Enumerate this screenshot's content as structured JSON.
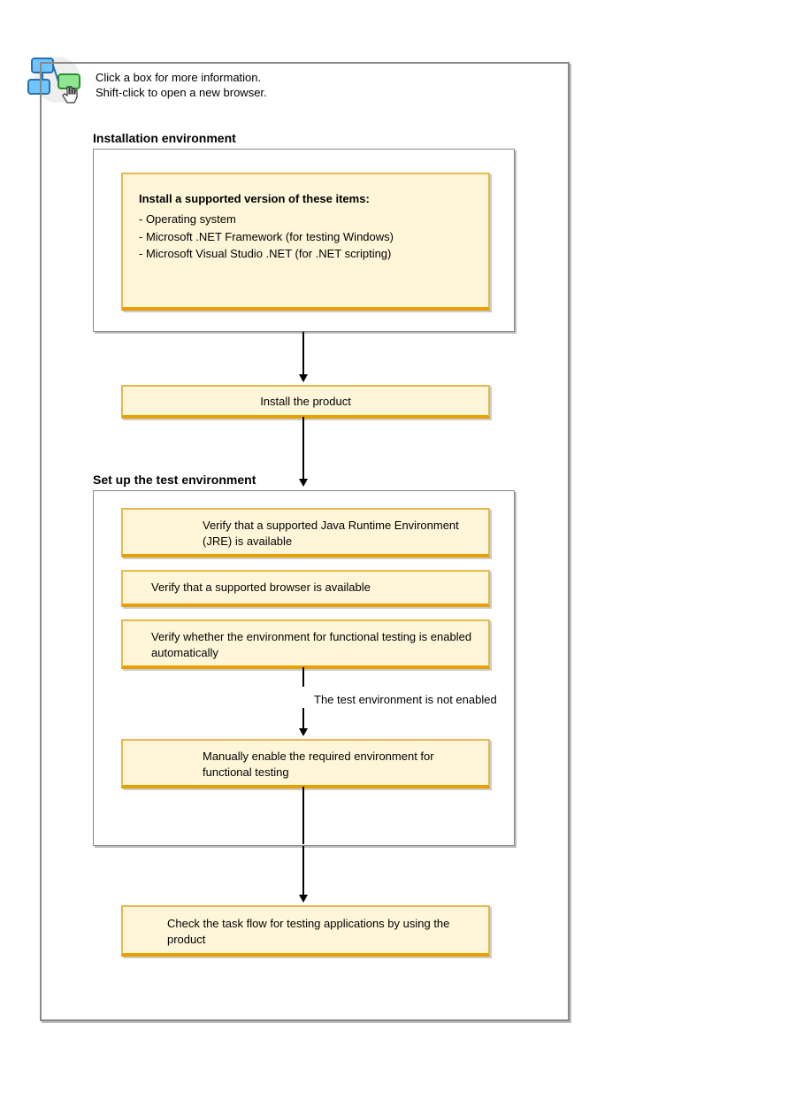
{
  "legend": {
    "line1": "Click a box for more information.",
    "line2": "Shift-click to open a new browser."
  },
  "section1": {
    "title": "Installation environment",
    "box1": {
      "heading": "Install a supported version of these items:",
      "item1": "- Operating system",
      "item2": "- Microsoft .NET Framework (for testing Windows)",
      "item3": "- Microsoft Visual Studio .NET (for .NET scripting)"
    }
  },
  "box_install_product": "Install the product",
  "section2": {
    "title": "Set up the test environment",
    "box_jre": "Verify that a supported Java Runtime Environment (JRE) is available",
    "box_browser": "Verify that a supported browser is available",
    "box_verify_env": "Verify whether the environment for functional testing is enabled automatically",
    "note_not_enabled": "The test environment is not enabled",
    "box_manual_enable": "Manually enable the required environment for functional testing"
  },
  "box_check_taskflow": "Check the task flow for testing applications by using the product"
}
